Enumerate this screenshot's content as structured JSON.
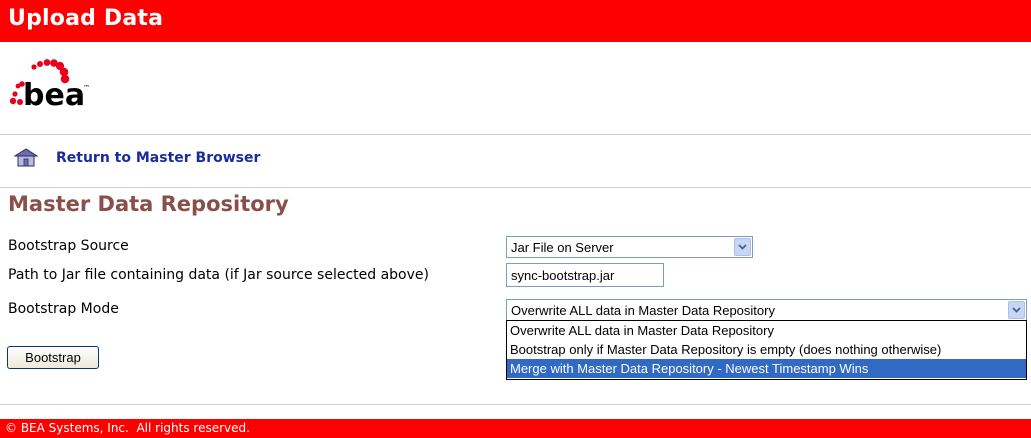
{
  "header": {
    "title": "Upload Data"
  },
  "logo": {
    "icon": "bea-logo",
    "text": "bea",
    "trademark": "™",
    "colors": {
      "arc": "#e8001c",
      "text": "#000000"
    }
  },
  "nav": {
    "icon": "home-icon",
    "return_label": "Return to Master Browser"
  },
  "section": {
    "heading": "Master Data Repository"
  },
  "form": {
    "bootstrap_source": {
      "label": "Bootstrap Source",
      "selected": "Jar File on Server"
    },
    "jar_path": {
      "label": "Path to Jar file containing data (if Jar source selected above)",
      "value": "sync-bootstrap.jar"
    },
    "bootstrap_mode": {
      "label": "Bootstrap Mode",
      "selected": "Overwrite ALL data in Master Data Repository",
      "options": [
        "Overwrite ALL data in Master Data Repository",
        "Bootstrap only if Master Data Repository is empty (does nothing otherwise)",
        "Merge with Master Data Repository - Newest Timestamp Wins"
      ],
      "highlighted_option": "Merge with Master Data Repository - Newest Timestamp Wins"
    },
    "submit_label": "Bootstrap"
  },
  "footer": {
    "copyright": "© BEA Systems, Inc.  All rights reserved."
  },
  "colors": {
    "brand_red": "#ff0000",
    "heading_brown": "#8a4f4a",
    "link_blue": "#1a2aa0",
    "highlight": "#316ac5"
  }
}
